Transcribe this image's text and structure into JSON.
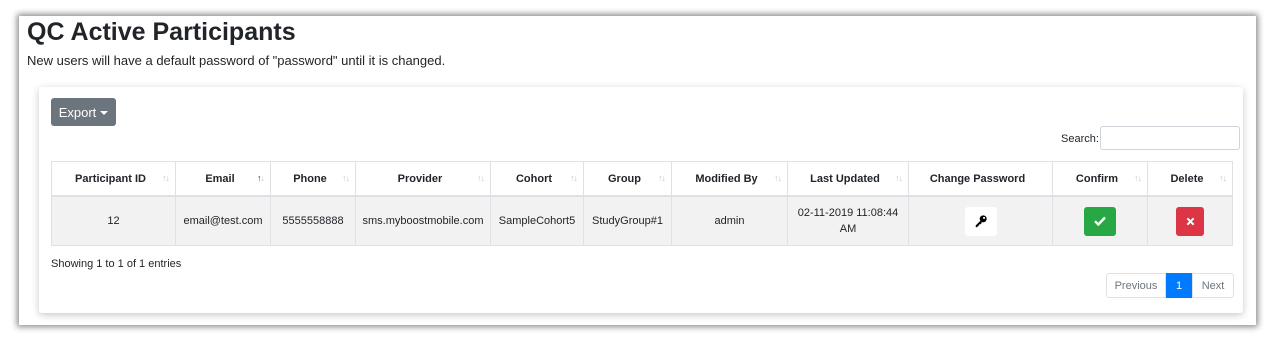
{
  "header": {
    "title": "QC Active Participants",
    "subtitle": "New users will have a default password of \"password\" until it is changed."
  },
  "toolbar": {
    "export_label": "Export",
    "search_label": "Search:",
    "search_value": ""
  },
  "table": {
    "columns": [
      "Participant ID",
      "Email",
      "Phone",
      "Provider",
      "Cohort",
      "Group",
      "Modified By",
      "Last Updated",
      "Change Password",
      "Confirm",
      "Delete"
    ],
    "sorted_column": "Email",
    "sort_direction": "ascending",
    "rows": [
      {
        "participant_id": "12",
        "email": "email@test.com",
        "phone": "5555558888",
        "provider": "sms.myboostmobile.com",
        "cohort": "SampleCohort5",
        "group": "StudyGroup#1",
        "modified_by": "admin",
        "last_updated": "02-11-2019 11:08:44 AM",
        "change_password_icon": "key-icon",
        "confirm_icon": "check-icon",
        "delete_icon": "times-icon"
      }
    ]
  },
  "footer": {
    "info": "Showing 1 to 1 of 1 entries",
    "pagination": {
      "previous": "Previous",
      "current": "1",
      "next": "Next"
    }
  },
  "colors": {
    "export_button": "#6c757d",
    "confirm_button": "#28a745",
    "delete_button": "#dc3545",
    "active_page": "#007bff",
    "row_background": "#f2f2f2"
  }
}
